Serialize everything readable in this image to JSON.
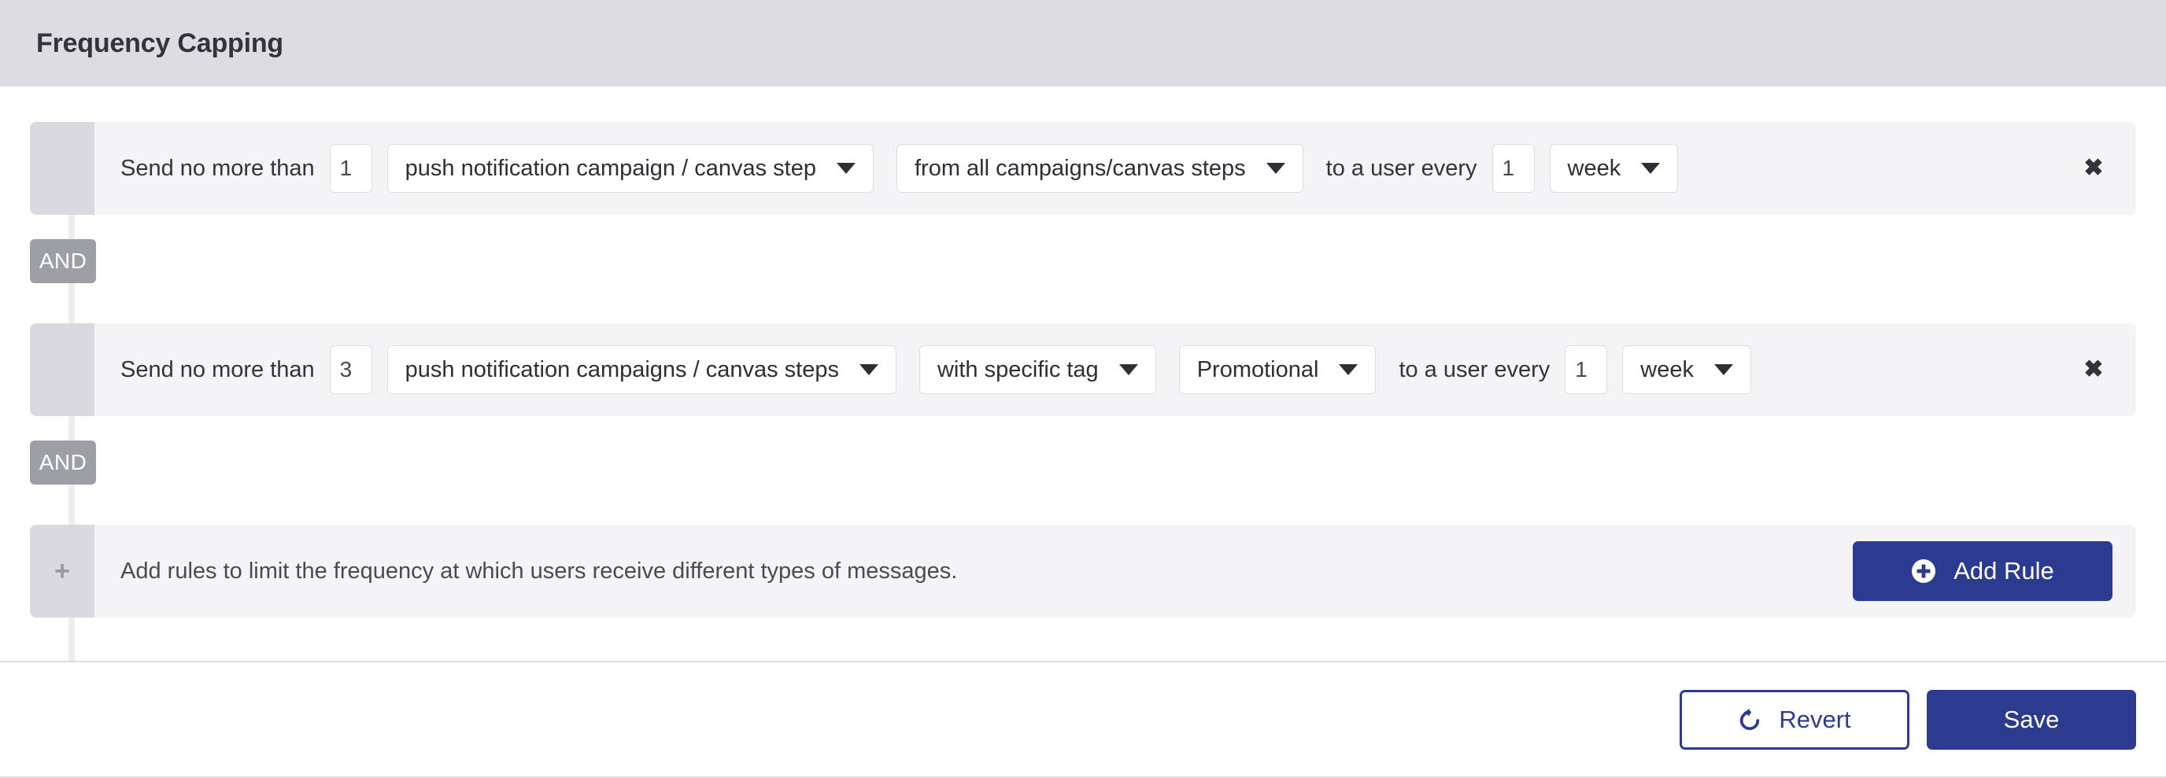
{
  "header": {
    "title": "Frequency Capping"
  },
  "colors": {
    "accent": "#2c3b8f",
    "header_bg": "#dcdce1",
    "row_bg": "#f4f4f6",
    "handle_bg": "#d9d9df",
    "and_badge_bg": "#9e9ea5"
  },
  "rules": [
    {
      "prefix_label": "Send no more than",
      "count_value": "1",
      "message_type": "push notification campaign / canvas step",
      "scope": "from all campaigns/canvas steps",
      "has_tag_select": false,
      "tag_value": "",
      "every_label": "to a user every",
      "interval_value": "1",
      "interval_unit": "week",
      "delete_icon": "close-icon",
      "drag_handle_icon": "drag-handle-icon"
    },
    {
      "prefix_label": "Send no more than",
      "count_value": "3",
      "message_type": "push notification campaigns / canvas steps",
      "scope": "with specific tag",
      "has_tag_select": true,
      "tag_value": "Promotional",
      "every_label": "to a user every",
      "interval_value": "1",
      "interval_unit": "week",
      "delete_icon": "close-icon",
      "drag_handle_icon": "drag-handle-icon"
    }
  ],
  "connectors": [
    {
      "label": "AND"
    },
    {
      "label": "AND"
    }
  ],
  "add_rule_row": {
    "handle_icon": "plus-icon",
    "description": "Add rules to limit the frequency at which users receive different types of messages.",
    "button_label": "Add Rule",
    "button_icon": "plus-circle-icon"
  },
  "footer": {
    "revert_label": "Revert",
    "revert_icon": "undo-icon",
    "save_label": "Save"
  }
}
